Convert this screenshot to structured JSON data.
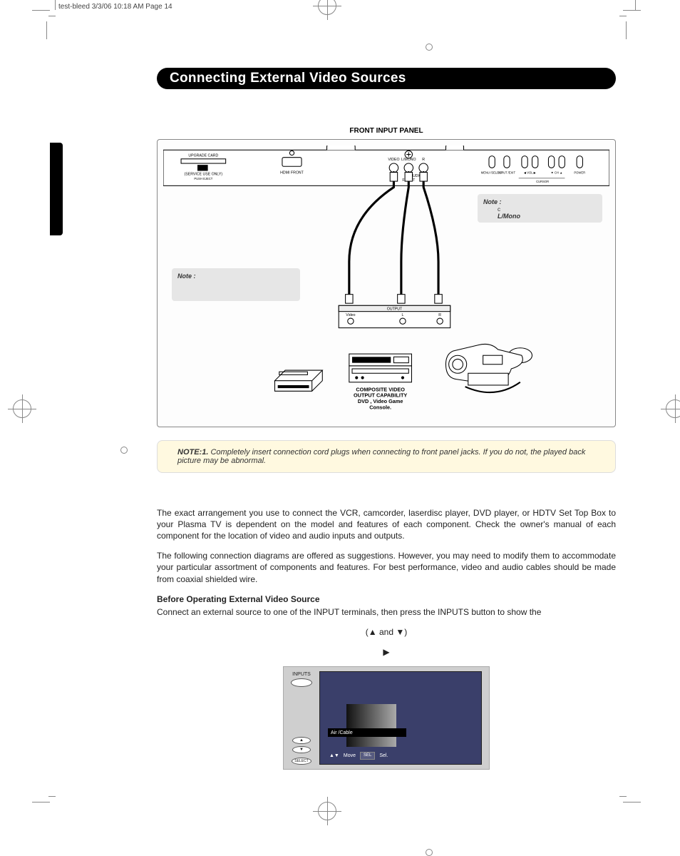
{
  "slug": "test-bleed  3/3/06  10:18 AM  Page 14",
  "title": "Connecting External Video Sources",
  "figure_label": "FRONT INPUT PANEL",
  "panel_labels": {
    "upgrade_card": "UPGRADE CARD",
    "service_only": "(SERVICE USE ONLY)",
    "push_eject": "PUSH EJECT",
    "hdmi_front": "HDMI FRONT",
    "video": "VIDEO",
    "lmono": "L/MONO",
    "r": "R",
    "audio": "AUDIO",
    "front": "FRONT",
    "menu_select": "MENU /SELECT",
    "input_exit": "INPUT /EXIT",
    "vol_down": "◀ VOL ▶",
    "ch": "▼ CH ▲",
    "power": "POWER",
    "cursor": "CURSOR"
  },
  "output_box": {
    "title": "OUTPUT",
    "video": "Video",
    "l": "L",
    "r": "R"
  },
  "note_left": "Note :",
  "note_right_title": "Note :",
  "note_right_sub": "c",
  "note_right_emph": "L/Mono",
  "device_caption_line1": "COMPOSITE VIDEO",
  "device_caption_line2": "OUTPUT CAPABILITY",
  "device_caption_line3": "DVD , Video Game",
  "device_caption_line4": "Console.",
  "yellow_note_prefix": "NOTE:1. ",
  "yellow_note_body": "Completely insert connection cord plugs when connecting to front panel jacks. If you do not, the played back picture may be abnormal.",
  "para1": "The exact arrangement you use to connect the VCR, camcorder, laserdisc player, DVD player, or HDTV Set Top Box to your Plasma TV is dependent on the model and features of each component.  Check the owner's manual of each component for the location of video and audio inputs and outputs.",
  "para2": "The following connection diagrams are offered as suggestions.  However, you may need to modify them to accommodate your particular assortment of components and features.  For best performance, video and audio cables should be made from coaxial shielded wire.",
  "sub_heading": "Before Operating External Video Source",
  "para3a": "Connect an external source to one of the INPUT terminals, then press the INPUTS button to show the",
  "para3b": "(▲ and  ▼)",
  "para3c": "▶",
  "tv": {
    "inputs_label": "INPUTS",
    "select_label": "SELECT",
    "selected": "Air /Cable",
    "move": "Move",
    "sel": "Sel."
  }
}
